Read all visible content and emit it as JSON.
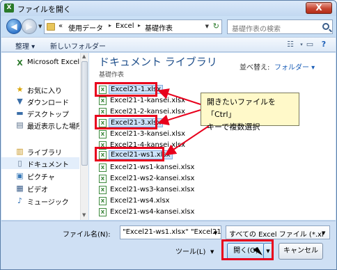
{
  "window": {
    "title": "ファイルを開く",
    "close_label": "X"
  },
  "address": {
    "segments": [
      "«",
      "使用データ",
      "Excel",
      "基礎作表"
    ]
  },
  "search": {
    "placeholder": "基礎作表の検索"
  },
  "toolbar": {
    "organize": "整理 ▾",
    "new_folder": "新しいフォルダー"
  },
  "nav": {
    "items": [
      {
        "label": "Microsoft Excel",
        "icon": "excel-icon"
      },
      {
        "label": "お気に入り",
        "icon": "star-icon"
      },
      {
        "label": "ダウンロード",
        "icon": "download-folder-icon"
      },
      {
        "label": "デスクトップ",
        "icon": "desktop-icon"
      },
      {
        "label": "最近表示した場所",
        "icon": "recent-places-icon"
      },
      {
        "label": "ライブラリ",
        "icon": "library-icon"
      },
      {
        "label": "ドキュメント",
        "icon": "documents-icon"
      },
      {
        "label": "ピクチャ",
        "icon": "pictures-icon"
      },
      {
        "label": "ビデオ",
        "icon": "videos-icon"
      },
      {
        "label": "ミュージック",
        "icon": "music-icon"
      }
    ]
  },
  "library": {
    "title": "ドキュメント ライブラリ",
    "subtitle": "基礎作表",
    "sort_label": "並べ替え:",
    "sort_value": "フォルダー ▾"
  },
  "files": [
    {
      "name": "Excel21-1.xlsx",
      "selected": true
    },
    {
      "name": "Excel21-1-kansei.xlsx",
      "selected": false
    },
    {
      "name": "Excel21-2-kansei.xlsx",
      "selected": false
    },
    {
      "name": "Excel21-3.xlsx",
      "selected": true
    },
    {
      "name": "Excel21-3-kansei.xlsx",
      "selected": false
    },
    {
      "name": "Excel21-4-kansei.xlsx",
      "selected": false
    },
    {
      "name": "Excel21-ws1.xlsx",
      "selected": true
    },
    {
      "name": "Excel21-ws1-kansei.xlsx",
      "selected": false
    },
    {
      "name": "Excel21-ws2-kansei.xlsx",
      "selected": false
    },
    {
      "name": "Excel21-ws3-kansei.xlsx",
      "selected": false
    },
    {
      "name": "Excel21-ws4.xlsx",
      "selected": false
    },
    {
      "name": "Excel21-ws4-kansei.xlsx",
      "selected": false
    }
  ],
  "callout": {
    "line1": "開きたいファイルを「Ctrl」",
    "line2": "キーで複数選択"
  },
  "bottom": {
    "filename_label": "ファイル名(N):",
    "filename_value": "\"Excel21-ws1.xlsx\" \"Excel21-",
    "filter_value": "すべての Excel ファイル (*.xl",
    "tools_label": "ツール(L)",
    "open_label": "開く(O)",
    "cancel_label": "キャンセル"
  },
  "colors": {
    "highlight": "#e8001c",
    "callout_bg": "#fff9c9",
    "library_title": "#1f4f8b"
  }
}
